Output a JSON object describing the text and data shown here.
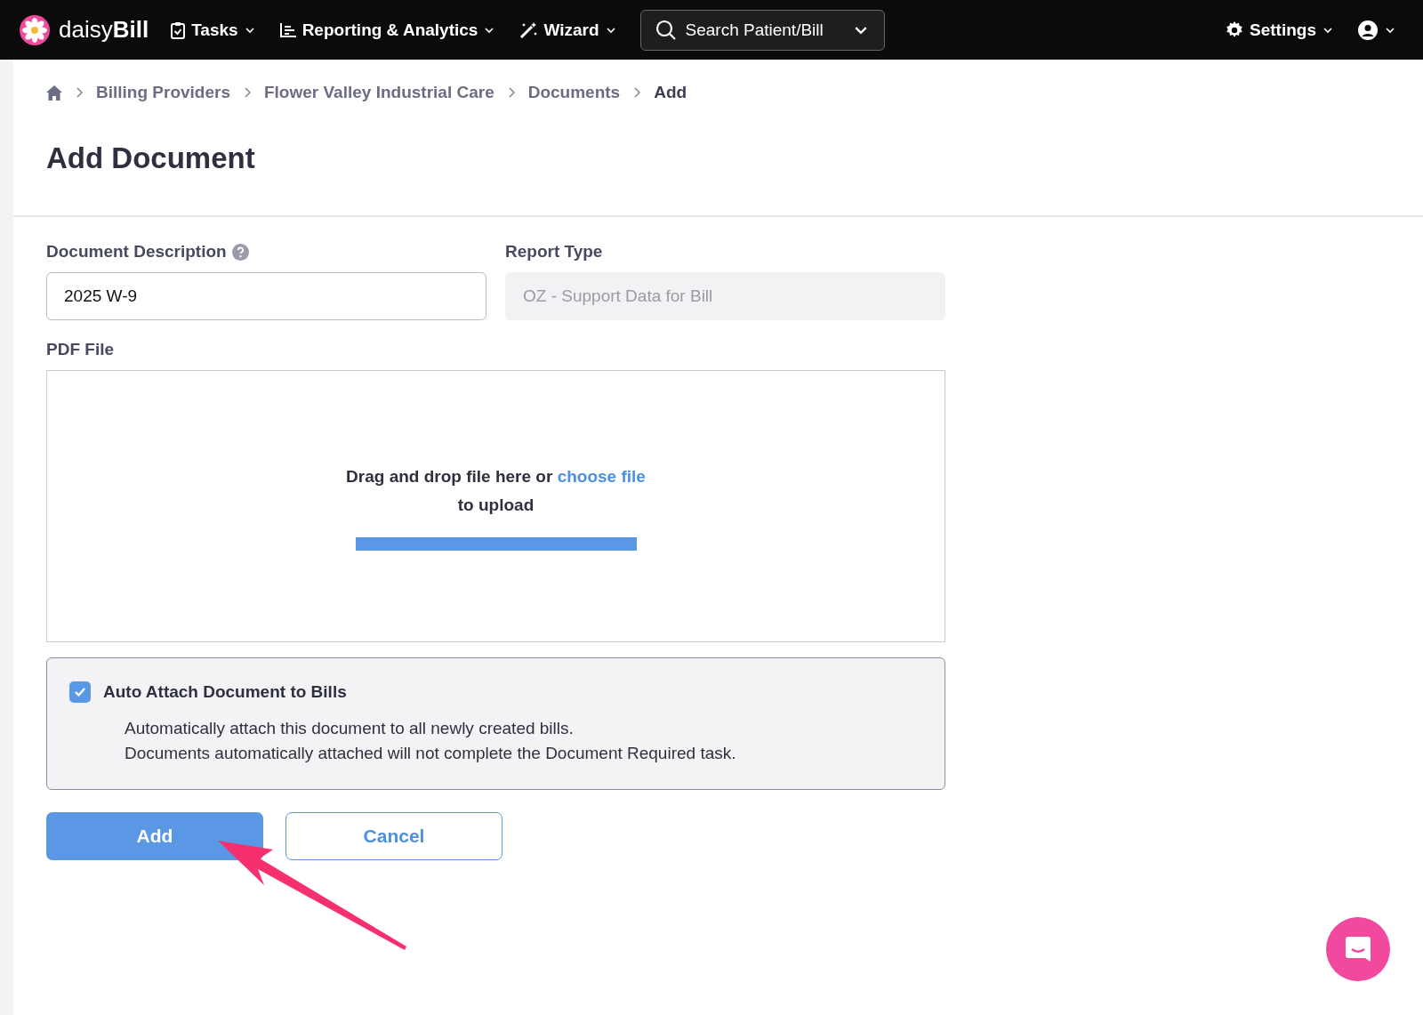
{
  "nav": {
    "brand_light": "daisy",
    "brand_bold": "Bill",
    "items": [
      {
        "label": "Tasks"
      },
      {
        "label": "Reporting & Analytics"
      },
      {
        "label": "Wizard"
      }
    ],
    "search": {
      "placeholder": "Search Patient/Bill"
    },
    "settings": "Settings"
  },
  "breadcrumb": [
    "Billing Providers",
    "Flower Valley Industrial Care",
    "Documents",
    "Add"
  ],
  "title": "Add Document",
  "fields": [
    {
      "label": "Document Description",
      "help": true,
      "value": "2025 W-9",
      "disabled": false
    },
    {
      "label": "Report Type",
      "help": false,
      "value": "OZ - Support Data for Bill",
      "disabled": true
    }
  ],
  "pdf": {
    "label": "PDF File",
    "text": "Drag and drop file here or",
    "link": "choose file",
    "text2": "to upload"
  },
  "auto_attach": {
    "label": "Auto Attach Document to Bills",
    "checked": true,
    "lines": [
      "Automatically attach this document to all newly created bills.",
      "Documents automatically attached will not complete the Document Required task."
    ]
  },
  "buttons": [
    {
      "label": "Add",
      "kind": "primary"
    },
    {
      "label": "Cancel",
      "kind": "secondary"
    }
  ]
}
